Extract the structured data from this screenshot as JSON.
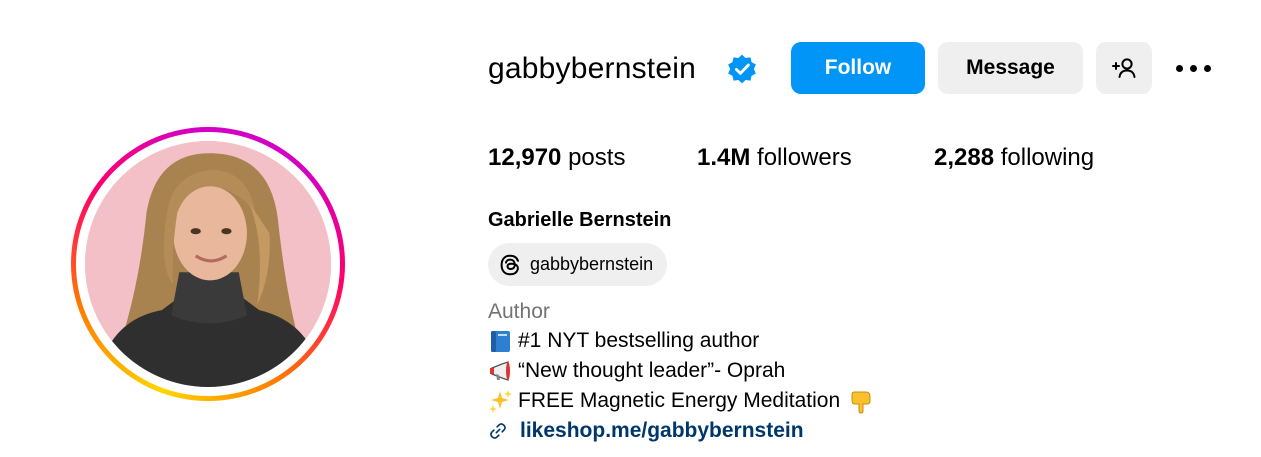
{
  "profile": {
    "username": "gabbybernstein",
    "verified_icon": "verified-badge-icon",
    "full_name": "Gabrielle Bernstein",
    "threads_handle": "gabbybernstein",
    "category": "Author"
  },
  "actions": {
    "follow_label": "Follow",
    "message_label": "Message",
    "add_user_icon": "add-user-icon",
    "more_icon": "more-options-icon"
  },
  "stats": {
    "posts_count": "12,970",
    "posts_label": "posts",
    "followers_count": "1.4M",
    "followers_label": "followers",
    "following_count": "2,288",
    "following_label": "following"
  },
  "bio": {
    "line1": "#1 NYT bestselling author",
    "line1_icon": "blue-book-icon",
    "line2": "“New thought leader”- Oprah",
    "line2_icon": "megaphone-icon",
    "line3": "FREE Magnetic Energy Meditation",
    "line3_icon": "sparkles-icon",
    "line3_trailing_icon": "pointing-down-icon",
    "link": "likeshop.me/gabbybernstein",
    "link_icon": "link-icon"
  },
  "colors": {
    "follow_button": "#0095f6",
    "secondary_button": "#efefef",
    "verified_badge": "#0095f6",
    "link_text": "#00376b",
    "category_text": "#737373"
  }
}
